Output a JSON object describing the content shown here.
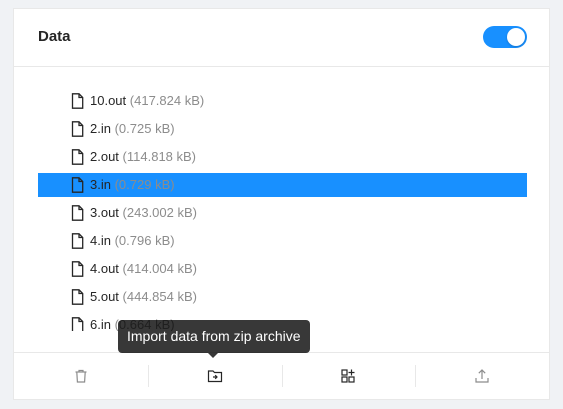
{
  "card": {
    "title": "Data",
    "toggle_on": true
  },
  "files": [
    {
      "name": "10.out",
      "size": "(417.824 kB)",
      "selected": false
    },
    {
      "name": "2.in",
      "size": "(0.725 kB)",
      "selected": false
    },
    {
      "name": "2.out",
      "size": "(114.818 kB)",
      "selected": false
    },
    {
      "name": "3.in",
      "size": "(0.729 kB)",
      "selected": true
    },
    {
      "name": "3.out",
      "size": "(243.002 kB)",
      "selected": false
    },
    {
      "name": "4.in",
      "size": "(0.796 kB)",
      "selected": false
    },
    {
      "name": "4.out",
      "size": "(414.004 kB)",
      "selected": false
    },
    {
      "name": "5.out",
      "size": "(444.854 kB)",
      "selected": false
    },
    {
      "name": "6.in",
      "size": "(0.664 kB)",
      "selected": false
    }
  ],
  "actions": [
    {
      "name": "delete-button",
      "icon": "trash-icon"
    },
    {
      "name": "import-zip-button",
      "icon": "folder-import-icon"
    },
    {
      "name": "manage-files-button",
      "icon": "grid-plus-icon"
    },
    {
      "name": "upload-button",
      "icon": "upload-icon"
    }
  ],
  "tooltip": {
    "text": "Import data from zip archive"
  },
  "colors": {
    "accent": "#1890ff",
    "muted_text": "#8c8c8c"
  }
}
